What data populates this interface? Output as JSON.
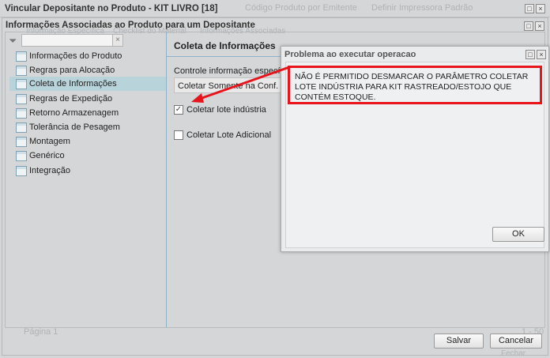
{
  "background": {
    "toolbar_items": [
      "Código Produto por Emitente",
      "Definir Impressora Padrão"
    ],
    "subtabs": [
      "Informação Específica",
      "Checklist do Material",
      "Informações Associadas"
    ],
    "pager": {
      "page": "Página 1",
      "range": "1 - 50"
    },
    "close_label": "Fechar"
  },
  "outer_window": {
    "title": "Vincular Depositante no Produto - KIT LIVRO [18]"
  },
  "inner_window": {
    "title": "Informações Associadas ao Produto para um Depositante"
  },
  "tree": {
    "filter_value": "",
    "items": [
      "Informações do Produto",
      "Regras para Alocação",
      "Coleta de Informações",
      "Regras de Expedição",
      "Retorno Armazenagem",
      "Tolerância de Pesagem",
      "Montagem",
      "Genérico",
      "Integração"
    ],
    "selected": "Coleta de Informações"
  },
  "panel": {
    "title": "Coleta de Informações",
    "control_label": "Controle informação específica:",
    "control_value": "Coletar Somente na Conf. de",
    "checkbox1": {
      "label": "Coletar lote indústria",
      "checked": true
    },
    "checkbox2": {
      "label": "Coletar Lote Adicional",
      "checked": false
    }
  },
  "dialog": {
    "title": "Problema ao executar operacao",
    "message": "NÃO É PERMITIDO DESMARCAR O PARÂMETRO COLETAR LOTE INDÚSTRIA PARA KIT RASTREADO/ESTOJO QUE CONTÉM ESTOQUE.",
    "ok_label": "OK"
  },
  "footer": {
    "save_label": "Salvar",
    "cancel_label": "Cancelar"
  },
  "colors": {
    "annotation": "#e8141c",
    "selected": "#b9d3da"
  }
}
